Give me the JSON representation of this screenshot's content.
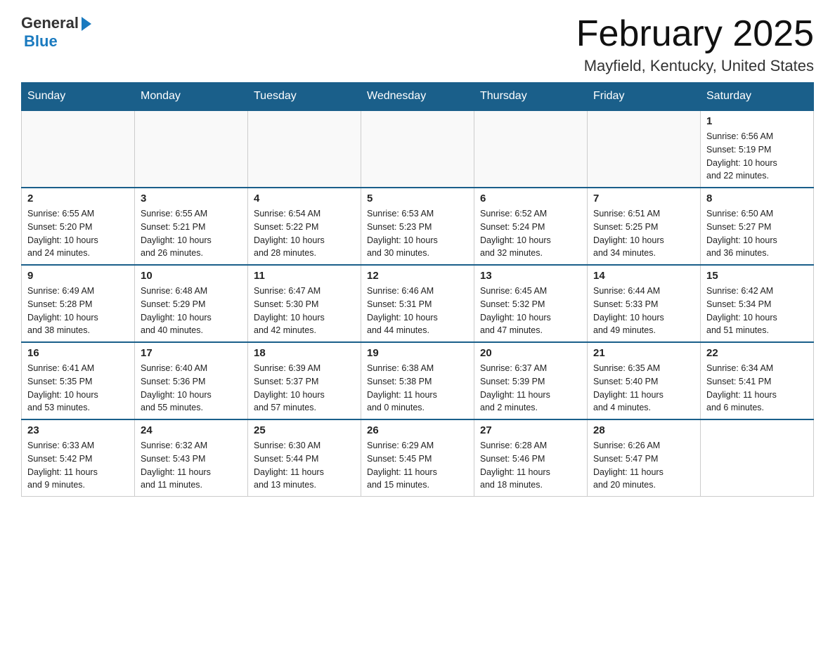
{
  "header": {
    "logo_general": "General",
    "logo_blue": "Blue",
    "month_title": "February 2025",
    "location": "Mayfield, Kentucky, United States"
  },
  "weekdays": [
    "Sunday",
    "Monday",
    "Tuesday",
    "Wednesday",
    "Thursday",
    "Friday",
    "Saturday"
  ],
  "weeks": [
    [
      {
        "day": "",
        "info": ""
      },
      {
        "day": "",
        "info": ""
      },
      {
        "day": "",
        "info": ""
      },
      {
        "day": "",
        "info": ""
      },
      {
        "day": "",
        "info": ""
      },
      {
        "day": "",
        "info": ""
      },
      {
        "day": "1",
        "info": "Sunrise: 6:56 AM\nSunset: 5:19 PM\nDaylight: 10 hours\nand 22 minutes."
      }
    ],
    [
      {
        "day": "2",
        "info": "Sunrise: 6:55 AM\nSunset: 5:20 PM\nDaylight: 10 hours\nand 24 minutes."
      },
      {
        "day": "3",
        "info": "Sunrise: 6:55 AM\nSunset: 5:21 PM\nDaylight: 10 hours\nand 26 minutes."
      },
      {
        "day": "4",
        "info": "Sunrise: 6:54 AM\nSunset: 5:22 PM\nDaylight: 10 hours\nand 28 minutes."
      },
      {
        "day": "5",
        "info": "Sunrise: 6:53 AM\nSunset: 5:23 PM\nDaylight: 10 hours\nand 30 minutes."
      },
      {
        "day": "6",
        "info": "Sunrise: 6:52 AM\nSunset: 5:24 PM\nDaylight: 10 hours\nand 32 minutes."
      },
      {
        "day": "7",
        "info": "Sunrise: 6:51 AM\nSunset: 5:25 PM\nDaylight: 10 hours\nand 34 minutes."
      },
      {
        "day": "8",
        "info": "Sunrise: 6:50 AM\nSunset: 5:27 PM\nDaylight: 10 hours\nand 36 minutes."
      }
    ],
    [
      {
        "day": "9",
        "info": "Sunrise: 6:49 AM\nSunset: 5:28 PM\nDaylight: 10 hours\nand 38 minutes."
      },
      {
        "day": "10",
        "info": "Sunrise: 6:48 AM\nSunset: 5:29 PM\nDaylight: 10 hours\nand 40 minutes."
      },
      {
        "day": "11",
        "info": "Sunrise: 6:47 AM\nSunset: 5:30 PM\nDaylight: 10 hours\nand 42 minutes."
      },
      {
        "day": "12",
        "info": "Sunrise: 6:46 AM\nSunset: 5:31 PM\nDaylight: 10 hours\nand 44 minutes."
      },
      {
        "day": "13",
        "info": "Sunrise: 6:45 AM\nSunset: 5:32 PM\nDaylight: 10 hours\nand 47 minutes."
      },
      {
        "day": "14",
        "info": "Sunrise: 6:44 AM\nSunset: 5:33 PM\nDaylight: 10 hours\nand 49 minutes."
      },
      {
        "day": "15",
        "info": "Sunrise: 6:42 AM\nSunset: 5:34 PM\nDaylight: 10 hours\nand 51 minutes."
      }
    ],
    [
      {
        "day": "16",
        "info": "Sunrise: 6:41 AM\nSunset: 5:35 PM\nDaylight: 10 hours\nand 53 minutes."
      },
      {
        "day": "17",
        "info": "Sunrise: 6:40 AM\nSunset: 5:36 PM\nDaylight: 10 hours\nand 55 minutes."
      },
      {
        "day": "18",
        "info": "Sunrise: 6:39 AM\nSunset: 5:37 PM\nDaylight: 10 hours\nand 57 minutes."
      },
      {
        "day": "19",
        "info": "Sunrise: 6:38 AM\nSunset: 5:38 PM\nDaylight: 11 hours\nand 0 minutes."
      },
      {
        "day": "20",
        "info": "Sunrise: 6:37 AM\nSunset: 5:39 PM\nDaylight: 11 hours\nand 2 minutes."
      },
      {
        "day": "21",
        "info": "Sunrise: 6:35 AM\nSunset: 5:40 PM\nDaylight: 11 hours\nand 4 minutes."
      },
      {
        "day": "22",
        "info": "Sunrise: 6:34 AM\nSunset: 5:41 PM\nDaylight: 11 hours\nand 6 minutes."
      }
    ],
    [
      {
        "day": "23",
        "info": "Sunrise: 6:33 AM\nSunset: 5:42 PM\nDaylight: 11 hours\nand 9 minutes."
      },
      {
        "day": "24",
        "info": "Sunrise: 6:32 AM\nSunset: 5:43 PM\nDaylight: 11 hours\nand 11 minutes."
      },
      {
        "day": "25",
        "info": "Sunrise: 6:30 AM\nSunset: 5:44 PM\nDaylight: 11 hours\nand 13 minutes."
      },
      {
        "day": "26",
        "info": "Sunrise: 6:29 AM\nSunset: 5:45 PM\nDaylight: 11 hours\nand 15 minutes."
      },
      {
        "day": "27",
        "info": "Sunrise: 6:28 AM\nSunset: 5:46 PM\nDaylight: 11 hours\nand 18 minutes."
      },
      {
        "day": "28",
        "info": "Sunrise: 6:26 AM\nSunset: 5:47 PM\nDaylight: 11 hours\nand 20 minutes."
      },
      {
        "day": "",
        "info": ""
      }
    ]
  ]
}
